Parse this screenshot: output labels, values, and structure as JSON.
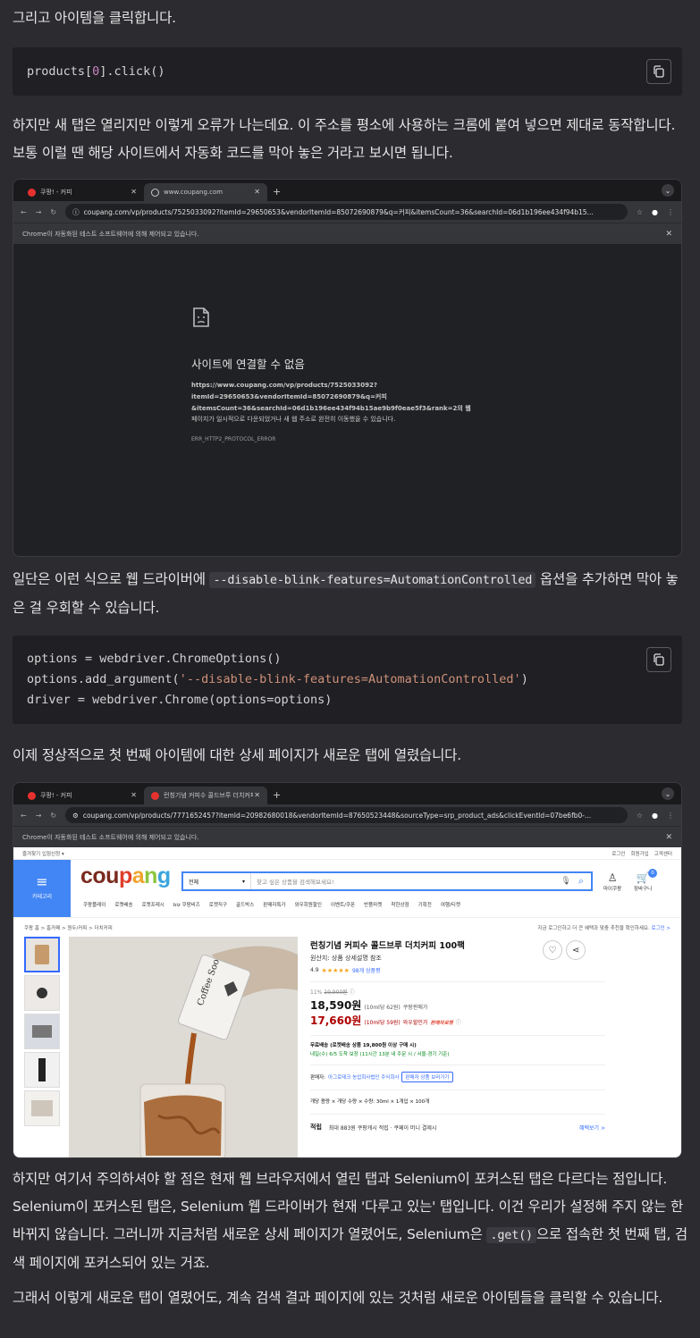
{
  "para1": "그리고 아이템을 클릭합니다.",
  "code1": {
    "lines": [
      "products[0].click()"
    ]
  },
  "para2": "하지만 새 탭은 열리지만 이렇게 오류가 나는데요. 이 주소를 평소에 사용하는 크롬에 붙여 넣으면 제대로 동작합니다. 보통 이럴 땐 해당 사이트에서 자동화 코드를 막아 놓은 거라고 보시면 됩니다.",
  "browser1": {
    "tab1": "쿠팡! - 커피",
    "tab2": "www.coupang.com",
    "url": "coupang.com/vp/products/7525033092?itemId=29650653&vendorItemId=85072690879&q=커피&itemsCount=36&searchId=06d1b196ee434f94b15...",
    "infobar": "Chrome이 자동화된 테스트 소프트웨어에 의해 제어되고 있습니다.",
    "error_title": "사이트에 연결할 수 없음",
    "error_url": "https://www.coupang.com/vp/products/7525033092?\nitemId=29650653&vendorItemId=85072690879&q=커피\n&itemsCount=36&searchId=06d1b196ee434f94b15ae9b9f0eae5f3&rank=2의 웹",
    "error_desc": "페이지가 일시적으로 다운되었거나 새 웹 주소로 완전히 이동했을 수 있습니다.",
    "error_code": "ERR_HTTP2_PROTOCOL_ERROR"
  },
  "para3_before": "일단은 이런 식으로 웹 드라이버에 ",
  "para3_code": "--disable-blink-features=AutomationControlled",
  "para3_after": " 옵션을 추가하면 막아 놓은 걸 우회할 수 있습니다.",
  "code2": {
    "line1": "options = webdriver.ChromeOptions()",
    "line2_a": "options.add_argument(",
    "line2_b": "'--disable-blink-features=AutomationControlled'",
    "line2_c": ")",
    "line3": "driver = webdriver.Chrome(options=options)"
  },
  "para4": "이제 정상적으로 첫 번째 아이템에 대한 상세 페이지가 새로운 탭에 열렸습니다.",
  "browser2": {
    "tab1": "쿠팡! - 커피",
    "tab2": "런칭기념 커피수 콜드브루 더치커피",
    "url": "coupang.com/vp/products/7771652457?itemId=20982680018&vendorItemId=87650523448&sourceType=srp_product_ads&clickEventId=07be6fb0-...",
    "infobar": "Chrome이 자동화된 테스트 소프트웨어에 의해 제어되고 있습니다.",
    "topbar_left": "즐겨찾기   입점신청 ▾",
    "topbar_right": [
      "로그인",
      "회원가입",
      "고객센터"
    ],
    "menu_label": "카테고리",
    "logo": "coupang",
    "search_category": "전체",
    "search_placeholder": "찾고 싶은 상품을 검색해보세요!",
    "mycoupang": "마이쿠팡",
    "cart": "장바구니",
    "cart_count": "0",
    "nav": [
      "쿠팡플레이",
      "로켓배송",
      "로켓프레시",
      "biz 쿠팡비즈",
      "로켓직구",
      "골드박스",
      "판매자특가",
      "와우회원할인",
      "이벤트/쿠폰",
      "반품마켓",
      "착한상점",
      "기획전",
      "여행/티켓"
    ],
    "breadcrumb": "쿠팡 홈 > 홈카페 > 원두/커피 > 더치커피",
    "login_notice": "지금 로그인하고 더 큰 혜택과 맞춤 추천을 확인하세요.",
    "login_link": "로그인 >",
    "product_title": "런칭기념 커피수 콜드브루 더치커피 100팩",
    "origin": "원산지: 상품 상세설명 참조",
    "rating": "4.9",
    "reviews": "98개 상품평",
    "discount": "11%",
    "orig_price": "19,900원",
    "price": "18,590원",
    "price_unit": "(10ml당 62원)",
    "price_label": "쿠팡판매가",
    "wow_price": "17,660원",
    "wow_unit": "(10ml당 59원)",
    "wow_label": "와우할인가",
    "wow_badge": "판매자로켓",
    "shipping": "무료배송 (로켓배송 상품 19,800원 이상 구매 시)",
    "arrival": "내일(수) 6/5 도착 보장 (11시간 13분 내 주문 시 / 서울·경기 기준)",
    "seller_label": "판매자:",
    "seller": "아그로테크 농업회사법인 주식회사",
    "seller_btn": "판매자 상품 보러가기",
    "spec": "개당 용량 × 개당 수량 × 수량:  30ml × 1개입 × 100개",
    "points_label": "적립",
    "points": "최대 883원 쿠팡캐시 적립 · 쿠페이 머니 결제시",
    "benefit_link": "혜택보기 >",
    "pouch_text": "Coffee Soo"
  },
  "para5_before": "하지만 여기서 주의하셔야 할 점은 현재 웹 브라우저에서 열린 탭과 Selenium이 포커스된 탭은 다르다는 점입니다. Selenium이 포커스된 탭은, Selenium 웹 드라이버가 현재 '다루고 있는' 탭입니다. 이건 우리가 설정해 주지 않는 한 바뀌지 않습니다. 그러니까 지금처럼 새로운 상세 페이지가 열렸어도, Selenium은 ",
  "para5_code": ".get()",
  "para5_after": "으로 접속한 첫 번째 탭, 검색 페이지에 포커스되어 있는 거죠.",
  "para6": "그래서 이렇게 새로운 탭이 열렸어도, 계속 검색 결과 페이지에 있는 것처럼 새로운 아이템들을 클릭할 수 있습니다."
}
